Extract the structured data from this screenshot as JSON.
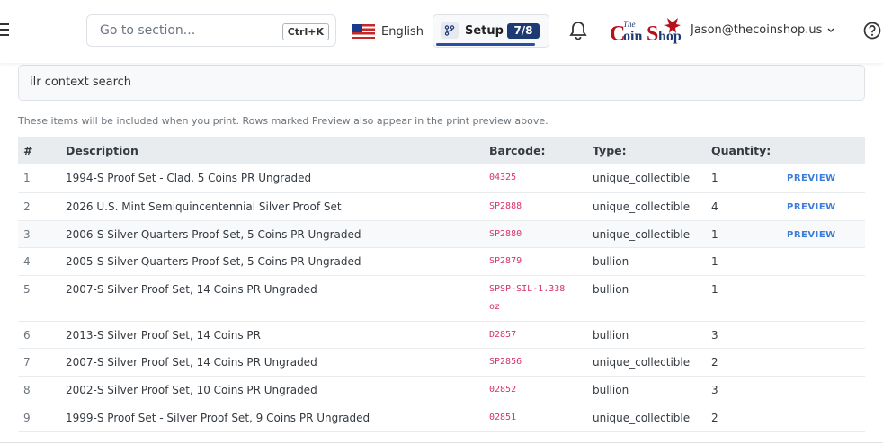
{
  "header": {
    "search_placeholder": "Go to section...",
    "search_shortcut": "Ctrl+K",
    "language": "English",
    "setup_label": "Setup",
    "setup_progress": "7/8",
    "logo_alt": "The Coin Shop",
    "user_email": "Jason@thecoinshop.us"
  },
  "context_search": {
    "value": "ilr context search"
  },
  "note": "These items will be included when you print. Rows marked Preview also appear in the print preview above.",
  "table": {
    "headers": [
      "#",
      "Description",
      "Barcode:",
      "Type:",
      "Quantity:",
      ""
    ],
    "rows": [
      {
        "num": "1",
        "description": "1994-S Proof Set - Clad, 5 Coins PR Ungraded",
        "barcode": "04325",
        "type": "unique_collectible",
        "quantity": "1",
        "preview": "PREVIEW"
      },
      {
        "num": "2",
        "description": "2026 U.S. Mint Semiquincentennial Silver Proof Set",
        "barcode": "SP2888",
        "type": "unique_collectible",
        "quantity": "4",
        "preview": "PREVIEW"
      },
      {
        "num": "3",
        "description": "2006-S Silver Quarters Proof Set, 5 Coins PR Ungraded",
        "barcode": "SP2880",
        "type": "unique_collectible",
        "quantity": "1",
        "preview": "PREVIEW"
      },
      {
        "num": "4",
        "description": "2005-S Silver Quarters Proof Set, 5 Coins PR Ungraded",
        "barcode": "SP2879",
        "type": "bullion",
        "quantity": "1",
        "preview": ""
      },
      {
        "num": "5",
        "description": "2007-S Silver Proof Set, 14 Coins PR Ungraded",
        "barcode": "SPSP-SIL-1.338oz",
        "type": "bullion",
        "quantity": "1",
        "preview": ""
      },
      {
        "num": "6",
        "description": "2013-S Silver Proof Set, 14 Coins PR",
        "barcode": "D2857",
        "type": "bullion",
        "quantity": "3",
        "preview": ""
      },
      {
        "num": "7",
        "description": "2007-S Silver Proof Set, 14 Coins PR Ungraded",
        "barcode": "SP2856",
        "type": "unique_collectible",
        "quantity": "2",
        "preview": ""
      },
      {
        "num": "8",
        "description": "2002-S Silver Proof Set, 10 Coins PR Ungraded",
        "barcode": "02852",
        "type": "bullion",
        "quantity": "3",
        "preview": ""
      },
      {
        "num": "9",
        "description": "1999-S Proof Set - Silver Proof Set, 9 Coins PR Ungraded",
        "barcode": "02851",
        "type": "unique_collectible",
        "quantity": "2",
        "preview": ""
      }
    ]
  }
}
